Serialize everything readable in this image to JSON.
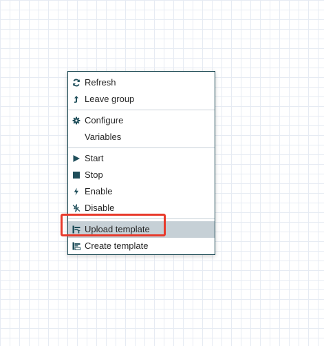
{
  "context_menu": {
    "groups": [
      {
        "items": [
          {
            "label": "Refresh",
            "icon": "refresh-icon"
          },
          {
            "label": "Leave group",
            "icon": "leave-group-icon"
          }
        ]
      },
      {
        "items": [
          {
            "label": "Configure",
            "icon": "gear-icon"
          },
          {
            "label": "Variables",
            "icon": ""
          }
        ]
      },
      {
        "items": [
          {
            "label": "Start",
            "icon": "play-icon"
          },
          {
            "label": "Stop",
            "icon": "stop-icon"
          },
          {
            "label": "Enable",
            "icon": "lightning-icon"
          },
          {
            "label": "Disable",
            "icon": "disable-lightning-icon"
          }
        ]
      },
      {
        "items": [
          {
            "label": "Upload template",
            "icon": "upload-template-icon",
            "highlighted": true
          },
          {
            "label": "Create template",
            "icon": "create-template-icon"
          }
        ]
      }
    ]
  },
  "colors": {
    "icon": "#1f4e5a",
    "text": "#262626",
    "menu_border": "#0f3f4a",
    "highlight": "#c6d0d6",
    "annotation": "#e8392a",
    "grid": "#e6ebf3"
  }
}
